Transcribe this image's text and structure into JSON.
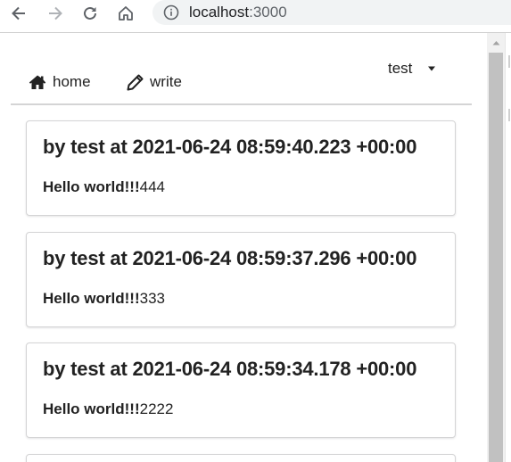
{
  "browser": {
    "url_host": "localhost",
    "url_port": ":3000",
    "icons": [
      "back-icon",
      "forward-icon",
      "reload-icon",
      "home-icon",
      "info-icon"
    ]
  },
  "nav": {
    "items": [
      {
        "label": "home",
        "icon": "home-icon"
      },
      {
        "label": "write",
        "icon": "pencil-icon"
      }
    ],
    "user": {
      "label": "test",
      "icon": "caret-down-icon"
    }
  },
  "posts": [
    {
      "title": "by test at 2021-06-24 08:59:40.223 +00:00",
      "body_bold": "Hello world!!!",
      "body_rest": "444"
    },
    {
      "title": "by test at 2021-06-24 08:59:37.296 +00:00",
      "body_bold": "Hello world!!!",
      "body_rest": "333"
    },
    {
      "title": "by test at 2021-06-24 08:59:34.178 +00:00",
      "body_bold": "Hello world!!!",
      "body_rest": "2222"
    }
  ],
  "colors": {
    "address_bar": "#f1f3f4",
    "card_border": "#d4d4d5",
    "scrollbar_thumb": "#c1c1c1"
  }
}
